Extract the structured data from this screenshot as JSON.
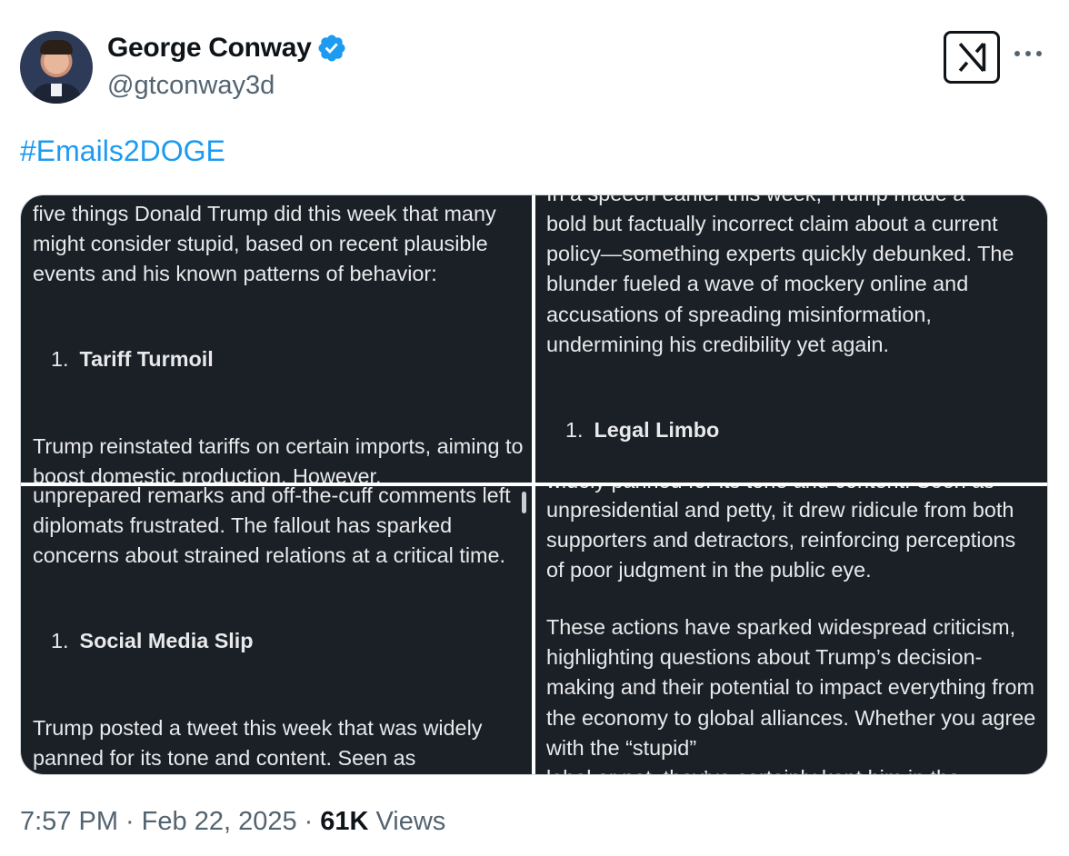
{
  "author": {
    "display_name": "George Conway",
    "handle": "@gtconway3d",
    "verified": true,
    "avatar_icon": "avatar-photo"
  },
  "header_icons": [
    "grok-icon",
    "more-icon"
  ],
  "tweet": {
    "text": "#Emails2DOGE"
  },
  "media": {
    "top_left": {
      "para1": "five things Donald Trump did this week that many might consider stupid, based on recent plausible events and his known patterns of behavior:",
      "item_num": "1.",
      "item_label": "Tariff Turmoil",
      "para2": "Trump reinstated tariffs on certain imports, aiming to boost domestic production. However,"
    },
    "top_right": {
      "para0": "In a speech earlier this week, Trump made a",
      "para1": "bold but factually incorrect claim about a current policy—something experts quickly debunked. The blunder fueled a wave of mockery online and accusations of spreading misinformation, undermining his credibility yet again.",
      "item_num": "1.",
      "item_label": "Legal Limbo"
    },
    "bottom_left": {
      "para1": "unprepared remarks and off-the-cuff comments left diplomats frustrated. The fallout has sparked concerns about strained relations at a critical time.",
      "item_num": "1.",
      "item_label": "Social Media Slip",
      "para2": "Trump posted a tweet this week that was widely panned for its tone and content. Seen as"
    },
    "bottom_right": {
      "para0": "widely panned for its tone and content. Seen as",
      "para1": "unpresidential and petty, it drew ridicule from both supporters and detractors, reinforcing perceptions of poor judgment in the public eye.",
      "para2": "These actions have sparked widespread criticism, highlighting questions about Trump’s decision-making and their potential to impact everything from the economy to global alliances. Whether you agree with the “stupid”",
      "para3": "label or not, they’ve certainly kept him in the"
    }
  },
  "meta": {
    "time": "7:57 PM",
    "sep1": "·",
    "date": "Feb 22, 2025",
    "sep2": "·",
    "views_count": "61K",
    "views_label": "Views"
  },
  "colors": {
    "link": "#1d9bf0",
    "verified": "#1d9bf0",
    "media_bg": "#1b1f26",
    "secondary_text": "#536471"
  }
}
